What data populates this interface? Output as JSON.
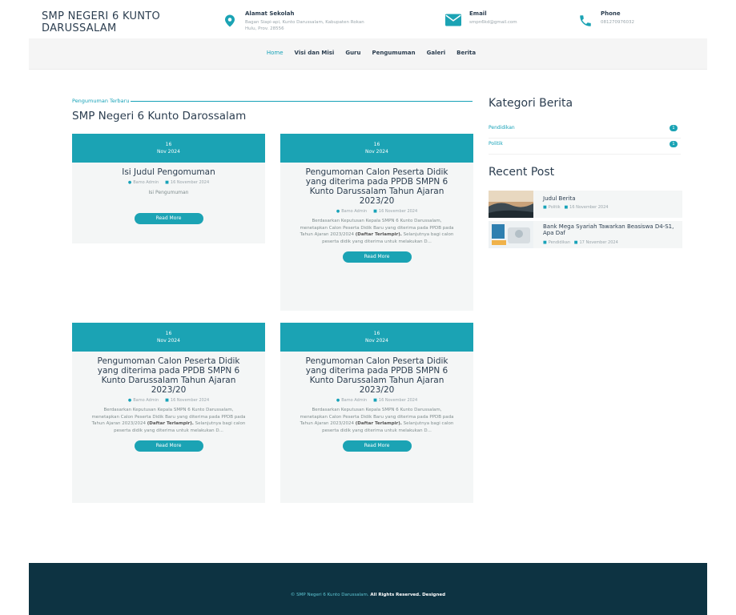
{
  "header": {
    "brand_line1": "SMP NEGERI 6 KUNTO",
    "brand_line2": "DARUSSALAM",
    "address_title": "Alamat Sekolah",
    "address_line1": "Bagan Siapi-api, Kunto Darussalam, Kabupaten Rokan",
    "address_line2": "Hulu, Prov. 28556",
    "email_title": "Email",
    "email_value": "smpn6kd@gmail.com",
    "phone_title": "Phone",
    "phone_value": "081270976032"
  },
  "nav": {
    "items": [
      {
        "label": "Home"
      },
      {
        "label": "Visi dan Misi"
      },
      {
        "label": "Guru"
      },
      {
        "label": "Pengumuman"
      },
      {
        "label": "Galeri"
      },
      {
        "label": "Berita"
      }
    ]
  },
  "main": {
    "sub_title": "Pengumuman Terbaru",
    "section_title": "SMP Negeri 6 Kunto Darossalam",
    "cards": [
      {
        "day": "16",
        "month_year": "Nov 2024",
        "title": "Isi Judul Pengomuman",
        "author": "Bamo Admin",
        "date": "16 November 2024",
        "body": "Isi Pengumuman",
        "read_more": "Read More"
      },
      {
        "day": "16",
        "month_year": "Nov 2024",
        "title": "Pengumoman Calon Peserta Didik yang diterima pada PPDB SMPN 6 Kunto Darussalam Tahun Ajaran 2023/20",
        "author": "Bamo Admin",
        "date": "16 November 2024",
        "body": "Berdasarkan Keputusan Kepala SMPN 6 Kunto Darussalam, menetapkan Calon Peserta Didik Baru yang diterima pada PPDB pada Tahun Ajaran 2023/2024",
        "body_bold": "(Daftar Terlampir).",
        "body_tail": "Selanjutnya bagi calon peserta didik yang diterima untuk melakukan D...",
        "read_more": "Read More"
      },
      {
        "day": "16",
        "month_year": "Nov 2024",
        "title": "Pengumoman Calon Peserta Didik yang diterima pada PPDB SMPN 6 Kunto Darussalam Tahun Ajaran 2023/20",
        "author": "Bamo Admin",
        "date": "16 November 2024",
        "body": "Berdasarkan Keputusan Kepala SMPN 6 Kunto Darussalam, menetapkan Calon Peserta Didik Baru yang diterima pada PPDB pada Tahun Ajaran 2023/2024",
        "body_bold": "(Daftar Terlampir).",
        "body_tail": "Selanjutnya bagi calon peserta didik yang diterima untuk melakukan D...",
        "read_more": "Read More"
      },
      {
        "day": "16",
        "month_year": "Nov 2024",
        "title": "Pengumoman Calon Peserta Didik yang diterima pada PPDB SMPN 6 Kunto Darussalam Tahun Ajaran 2023/20",
        "author": "Bamo Admin",
        "date": "16 November 2024",
        "body": "Berdasarkan Keputusan Kepala SMPN 6 Kunto Darussalam, menetapkan Calon Peserta Didik Baru yang diterima pada PPDB pada Tahun Ajaran 2023/2024",
        "body_bold": "(Daftar Terlampir).",
        "body_tail": "Selanjutnya bagi calon peserta didik yang diterima untuk melakukan D...",
        "read_more": "Read More"
      }
    ]
  },
  "sidebar": {
    "categories_title": "Kategori Berita",
    "categories": [
      {
        "label": "Pendidikan",
        "count": "1"
      },
      {
        "label": "Politik",
        "count": "1"
      }
    ],
    "recent_title": "Recent Post",
    "posts": [
      {
        "title": "Judul Berita",
        "category": "Politik",
        "date": "16 November 2024"
      },
      {
        "title": "Bank Mega Syariah Tawarkan Beasiswa D4-S1, Apa Daf",
        "category": "Pendidikan",
        "date": "17 November 2024"
      }
    ]
  },
  "footer": {
    "copyright": "© SMP Negeri 6 Kunto Darussalam.",
    "rights": "All Rights Reserved. Designed"
  },
  "colors": {
    "accent": "#1ba3b4",
    "footer_bg": "#0d3342",
    "heading": "#2c3e50"
  }
}
